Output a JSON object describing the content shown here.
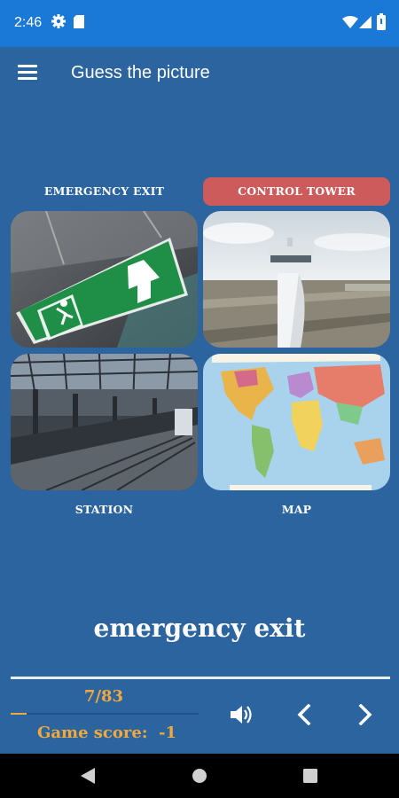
{
  "status_bar": {
    "time": "2:46"
  },
  "app_bar": {
    "title": "Guess the picture"
  },
  "options": [
    {
      "label": "EMERGENCY EXIT",
      "image": "emergency-exit-sign",
      "selected": false
    },
    {
      "label": "CONTROL TOWER",
      "image": "airport-control-tower",
      "selected": true
    },
    {
      "label": "STATION",
      "image": "railway-station-hall",
      "selected": false
    },
    {
      "label": "MAP",
      "image": "world-map",
      "selected": false
    }
  ],
  "answer": "emergency exit",
  "progress": {
    "text": "7/83",
    "fraction": 0.084
  },
  "score": {
    "label": "Game score:",
    "value": "-1"
  },
  "controls": {
    "sound_icon": "speaker-icon",
    "prev_icon": "chevron-left-icon",
    "next_icon": "chevron-right-icon"
  },
  "colors": {
    "status_bar": "#1a78d6",
    "background": "#2c64a0",
    "selected_label": "#cd5b5b",
    "accent": "#f2a93b"
  }
}
